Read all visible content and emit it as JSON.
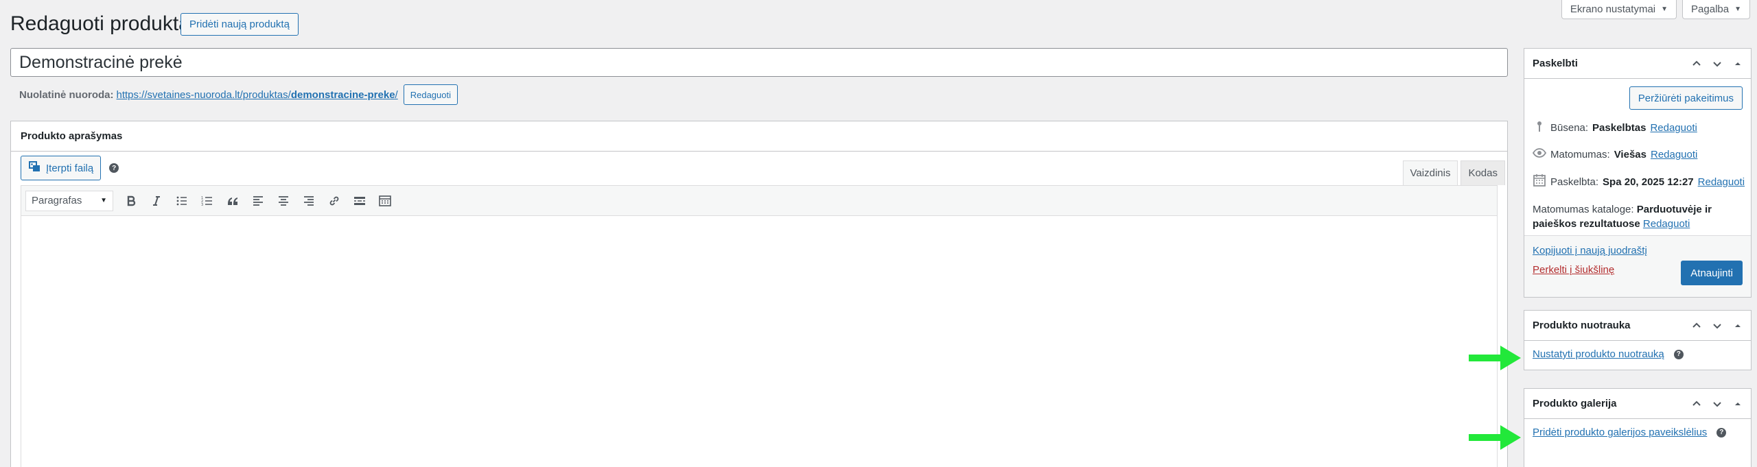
{
  "screen_meta": {
    "screen_options": "Ekrano nustatymai",
    "help": "Pagalba"
  },
  "header": {
    "title": "Redaguoti produktą",
    "add_new": "Pridėti naują produktą"
  },
  "post_title": "Demonstracinė prekė",
  "permalink": {
    "label": "Nuolatinė nuoroda:",
    "base": "https://svetaines-nuoroda.lt/produktas/",
    "slug": "demonstracine-preke",
    "trailing": "/",
    "edit": "Redaguoti"
  },
  "description": {
    "title": "Produkto aprašymas",
    "add_media": "Įterpti failą",
    "help": "?",
    "tabs": [
      "Vaizdinis",
      "Kodas"
    ],
    "format": "Paragrafas"
  },
  "publish": {
    "title": "Paskelbti",
    "preview": "Peržiūrėti pakeitimus",
    "status_label": "Būsena:",
    "status_value": "Paskelbtas",
    "visibility_label": "Matomumas:",
    "visibility_value": "Viešas",
    "published_label": "Paskelbta:",
    "published_value": "Spa 20, 2025 12:27",
    "edit": "Redaguoti",
    "catalog_label": "Matomumas kataloge:",
    "catalog_value": "Parduotuvėje ir paieškos rezultatuose",
    "copy_draft": "Kopijuoti į naują juodraštį",
    "trash": "Perkelti į šiukšlinę",
    "update": "Atnaujinti"
  },
  "product_image": {
    "title": "Produkto nuotrauka",
    "set_link": "Nustatyti produkto nuotrauką",
    "help": "?"
  },
  "product_gallery": {
    "title": "Produkto galerija",
    "add_link": "Pridėti produkto galerijos paveikslėlius",
    "help": "?"
  },
  "colors": {
    "accent": "#2271b1",
    "arrow": "#22e83a",
    "trash": "#b32d2e"
  }
}
